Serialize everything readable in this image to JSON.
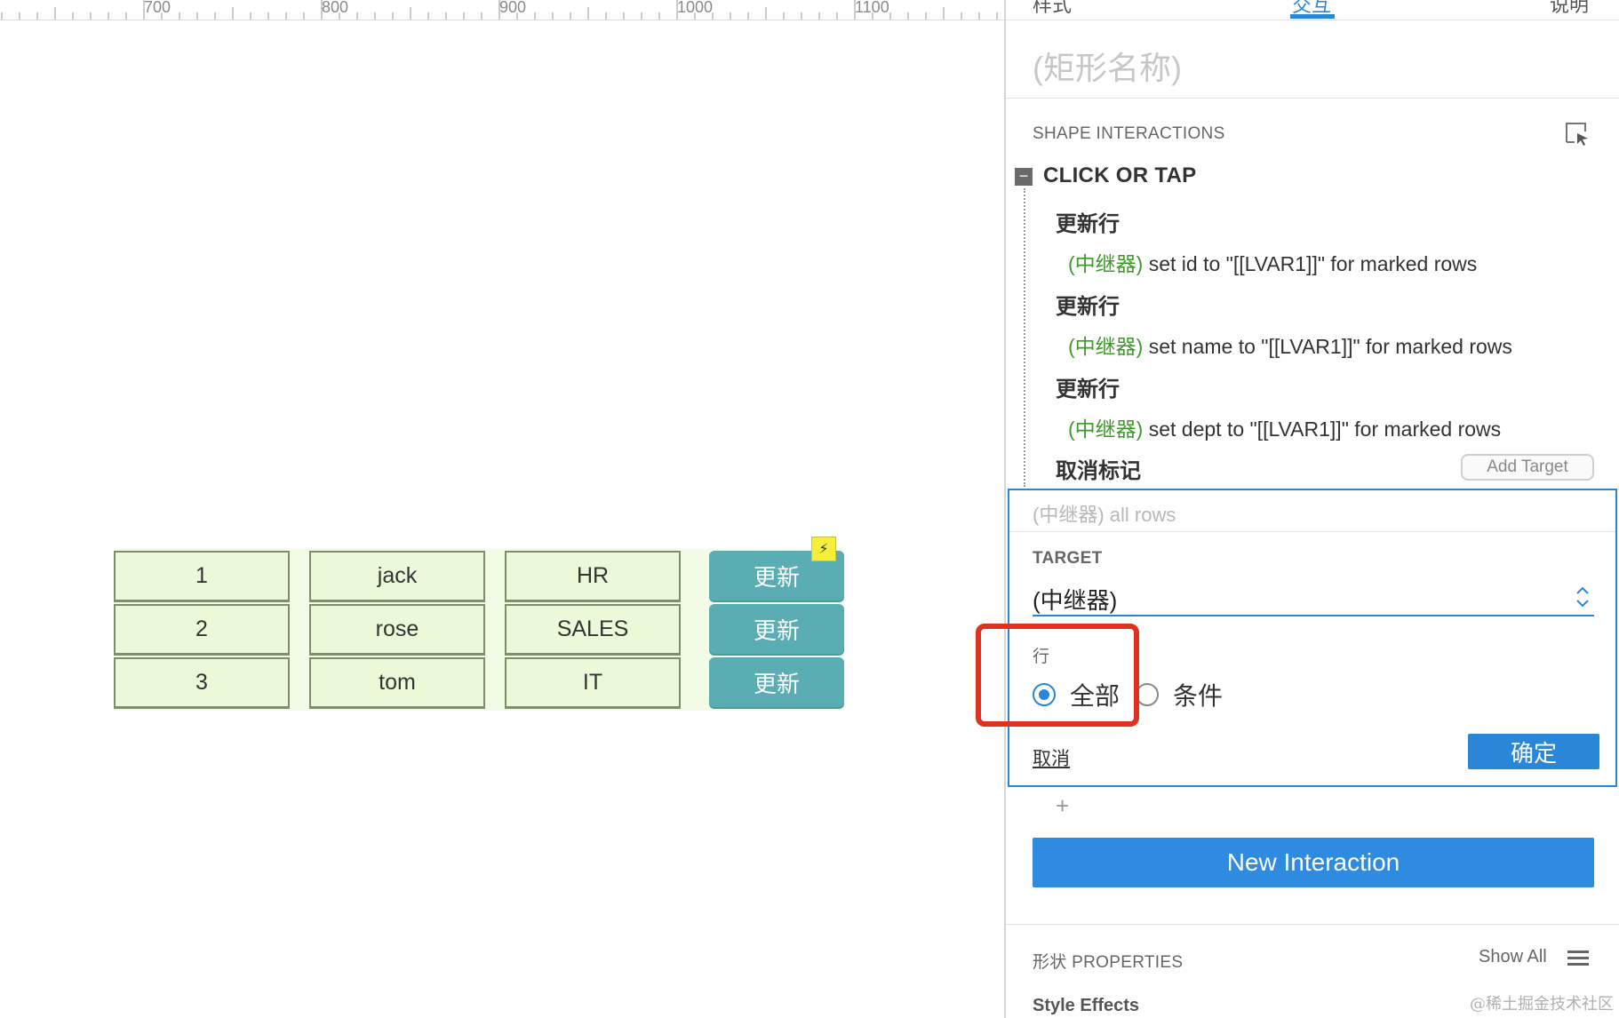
{
  "ruler": {
    "labels": [
      "700",
      "800",
      "900",
      "1000",
      "1100"
    ]
  },
  "repeater": {
    "rows": [
      {
        "id": "1",
        "name": "jack",
        "dept": "HR",
        "button": "更新"
      },
      {
        "id": "2",
        "name": "rose",
        "dept": "SALES",
        "button": "更新"
      },
      {
        "id": "3",
        "name": "tom",
        "dept": "IT",
        "button": "更新"
      }
    ],
    "interaction_badge": "⚡"
  },
  "panel": {
    "tabs": [
      "样式",
      "交互",
      "说明"
    ],
    "active_tab": "交互",
    "shape_name": "(矩形名称)",
    "section_title": "SHAPE INTERACTIONS",
    "event": {
      "collapse_symbol": "−",
      "title": "CLICK OR TAP"
    },
    "actions": [
      {
        "name": "更新行",
        "target": "(中继器)",
        "desc": " set id to \"[[LVAR1]]\" for marked rows"
      },
      {
        "name": "更新行",
        "target": "(中继器)",
        "desc": " set name to \"[[LVAR1]]\" for marked rows"
      },
      {
        "name": "更新行",
        "target": "(中继器)",
        "desc": " set dept to \"[[LVAR1]]\" for marked rows"
      },
      {
        "name": "取消标记"
      }
    ],
    "add_target_label": "Add Target",
    "editor": {
      "summary": "(中继器) all rows",
      "target_label": "TARGET",
      "target_value": "(中继器)",
      "rows_label": "行",
      "options": [
        {
          "label": "全部",
          "selected": true
        },
        {
          "label": "条件",
          "selected": false
        }
      ],
      "cancel_label": "取消",
      "ok_label": "确定"
    },
    "add_symbol": "+",
    "new_interaction_label": "New Interaction",
    "properties_title": "形状 PROPERTIES",
    "show_all_label": "Show All",
    "style_effects_label": "Style Effects"
  },
  "watermark": "@稀土掘金技术社区",
  "colors": {
    "accent": "#2a86d9",
    "highlight": "#e0301e",
    "cell_fill": "#ebf9d8",
    "update_button": "#5aadb3",
    "target_green": "#3e9a2b"
  }
}
